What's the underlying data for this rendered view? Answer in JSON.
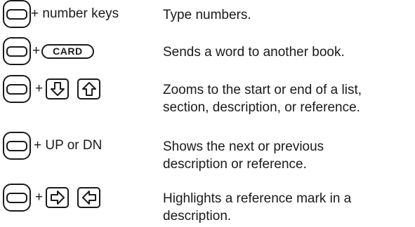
{
  "rows": [
    {
      "combo_text": "+ number keys",
      "description": [
        "Type numbers."
      ]
    },
    {
      "plus": "+",
      "key_label": "CARD",
      "description": [
        "Sends a word to another book."
      ]
    },
    {
      "plus": "+",
      "description": [
        "Zooms to the start or end of a list,",
        "section, description, or reference."
      ]
    },
    {
      "combo_text": "+ UP or DN",
      "description": [
        "Shows the next or previous",
        "description or reference."
      ]
    },
    {
      "plus": "+",
      "description": [
        "Highlights a reference mark in a",
        "description."
      ]
    }
  ],
  "icons": {
    "modifier_key": "modifier-key-icon",
    "card_key": "card-key-icon",
    "down_arrow_key": "down-arrow-key-icon",
    "up_arrow_key": "up-arrow-key-icon",
    "right_arrow_key": "right-arrow-key-icon",
    "left_arrow_key": "left-arrow-key-icon"
  }
}
